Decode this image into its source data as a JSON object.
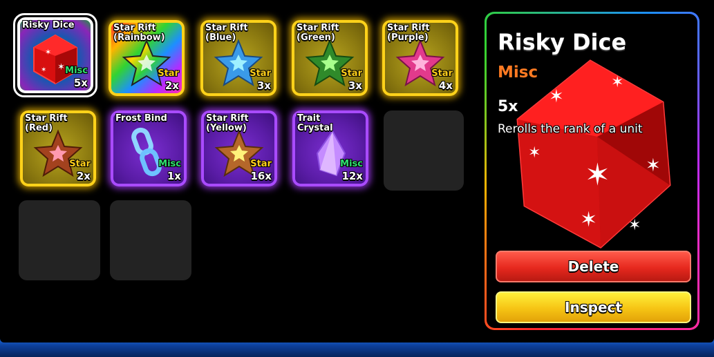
{
  "inventory": {
    "slots": [
      {
        "name": "Risky Dice",
        "tag": "Misc",
        "qty": "5x",
        "rarity": "rainbow",
        "selected": true,
        "icon": "dice-icon"
      },
      {
        "name": "Star Rift\n(Rainbow)",
        "tag": "Star",
        "qty": "2x",
        "rarity": "gold",
        "icon": "star-rainbow-icon"
      },
      {
        "name": "Star Rift\n(Blue)",
        "tag": "Star",
        "qty": "3x",
        "rarity": "gold",
        "icon": "star-blue-icon"
      },
      {
        "name": "Star Rift\n(Green)",
        "tag": "Star",
        "qty": "3x",
        "rarity": "gold",
        "icon": "star-green-icon"
      },
      {
        "name": "Star Rift\n(Purple)",
        "tag": "Star",
        "qty": "4x",
        "rarity": "gold",
        "icon": "star-pink-icon"
      },
      {
        "name": "Star Rift\n(Red)",
        "tag": "Star",
        "qty": "2x",
        "rarity": "gold",
        "icon": "star-red-icon"
      },
      {
        "name": "Frost Bind",
        "tag": "Misc",
        "qty": "1x",
        "rarity": "purple",
        "icon": "chain-icon"
      },
      {
        "name": "Star Rift\n(Yellow)",
        "tag": "Star",
        "qty": "16x",
        "rarity": "purple",
        "icon": "star-yellow-icon"
      },
      {
        "name": "Trait\nCrystal",
        "tag": "Misc",
        "qty": "12x",
        "rarity": "purple",
        "icon": "crystal-icon"
      }
    ]
  },
  "detail": {
    "title": "Risky Dice",
    "category": "Misc",
    "count": "5x",
    "description": "Rerolls the rank of a unit",
    "delete_label": "Delete",
    "inspect_label": "Inspect"
  },
  "colors": {
    "gold_border": "#ffd21a",
    "purple_border": "#a94bff",
    "delete_button": "#e6281e",
    "inspect_button": "#f6c414",
    "category_misc": "#ff7a22"
  }
}
